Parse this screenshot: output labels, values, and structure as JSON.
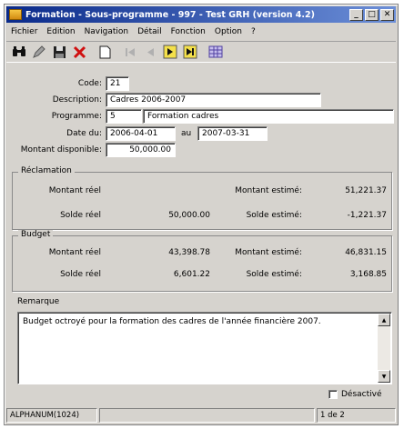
{
  "window": {
    "title": "Formation - Sous-programme - 997 - Test GRH (version 4.2)",
    "minimize_label": "_",
    "maximize_label": "□",
    "close_label": "✕"
  },
  "menu": [
    "Fichier",
    "Edition",
    "Navigation",
    "Détail",
    "Fonction",
    "Option",
    "?"
  ],
  "toolbar": {
    "icons": [
      "binoculars-icon",
      "pencil-icon",
      "save-icon",
      "delete-icon",
      "new-document-icon",
      "first-record-icon",
      "previous-record-icon",
      "next-record-icon",
      "last-record-icon",
      "grid-icon"
    ]
  },
  "form": {
    "code_label": "Code:",
    "code_value": "21",
    "description_label": "Description:",
    "description_value": "Cadres 2006-2007",
    "programme_label": "Programme:",
    "programme_code": "5",
    "programme_name": "Formation cadres",
    "date_label": "Date du:",
    "date_from": "2006-04-01",
    "date_to_label": "au",
    "date_to": "2007-03-31",
    "montant_dispo_label": "Montant disponible:",
    "montant_dispo_value": "50,000.00"
  },
  "reclamation": {
    "title": "Réclamation",
    "montant_reel_label": "Montant réel",
    "montant_reel_value": "",
    "montant_estime_label": "Montant estimé:",
    "montant_estime_value": "51,221.37",
    "solde_reel_label": "Solde réel",
    "solde_reel_value": "50,000.00",
    "solde_estime_label": "Solde estimé:",
    "solde_estime_value": "-1,221.37"
  },
  "budget": {
    "title": "Budget",
    "montant_reel_label": "Montant réel",
    "montant_reel_value": "43,398.78",
    "montant_estime_label": "Montant estimé:",
    "montant_estime_value": "46,831.15",
    "solde_reel_label": "Solde réel",
    "solde_reel_value": "6,601.22",
    "solde_estime_label": "Solde estimé:",
    "solde_estime_value": "3,168.85"
  },
  "remarque": {
    "label": "Remarque",
    "text": "Budget octroyé pour la formation des cadres de l'année financière 2007."
  },
  "desactive_label": "Désactivé",
  "status": {
    "field_type": "ALPHANUM(1024)",
    "record": "1 de 2"
  }
}
